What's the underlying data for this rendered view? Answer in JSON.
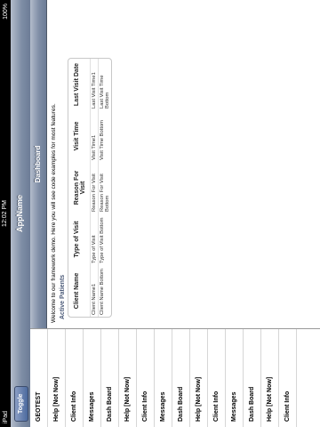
{
  "status": {
    "carrier": "iPad",
    "time": "12:02 PM",
    "battery": "100%"
  },
  "nav": {
    "title": "AppName",
    "toggle_label": "Toggle"
  },
  "sidebar": {
    "items": [
      {
        "label": "GEOTEST"
      },
      {
        "label": "Help [Not Now]"
      },
      {
        "label": "Client Info"
      },
      {
        "label": "Messages"
      },
      {
        "label": "Dash Board"
      },
      {
        "label": "Help [Not Now]"
      },
      {
        "label": "Client Info"
      },
      {
        "label": "Messages"
      },
      {
        "label": "Dash Board"
      },
      {
        "label": "Help [Not Now]"
      },
      {
        "label": "Client Info"
      },
      {
        "label": "Messages"
      },
      {
        "label": "Dash Board"
      },
      {
        "label": "Help [Not Now]"
      },
      {
        "label": "Client Info"
      }
    ]
  },
  "detail": {
    "header": "Dashboard",
    "welcome": "Welcome to our framework demo. Here you will see code examples for most features.",
    "section_title": "Active Patients",
    "table": {
      "columns": [
        "Client Name",
        "Type of Visit",
        "Reason For Visit",
        "Visit Time",
        "Last Visit Date"
      ],
      "rows": [
        [
          "Client Name1",
          "Type of Visit",
          "Reason For Visit",
          "Visit Time1",
          "Last Visit Time1"
        ],
        [
          "Client Name Bottom",
          "Type of Visit Bottom",
          "Reason For Visit Bottom",
          "Visit Time Bottom",
          "Last Visit Time Bottom"
        ]
      ]
    }
  }
}
